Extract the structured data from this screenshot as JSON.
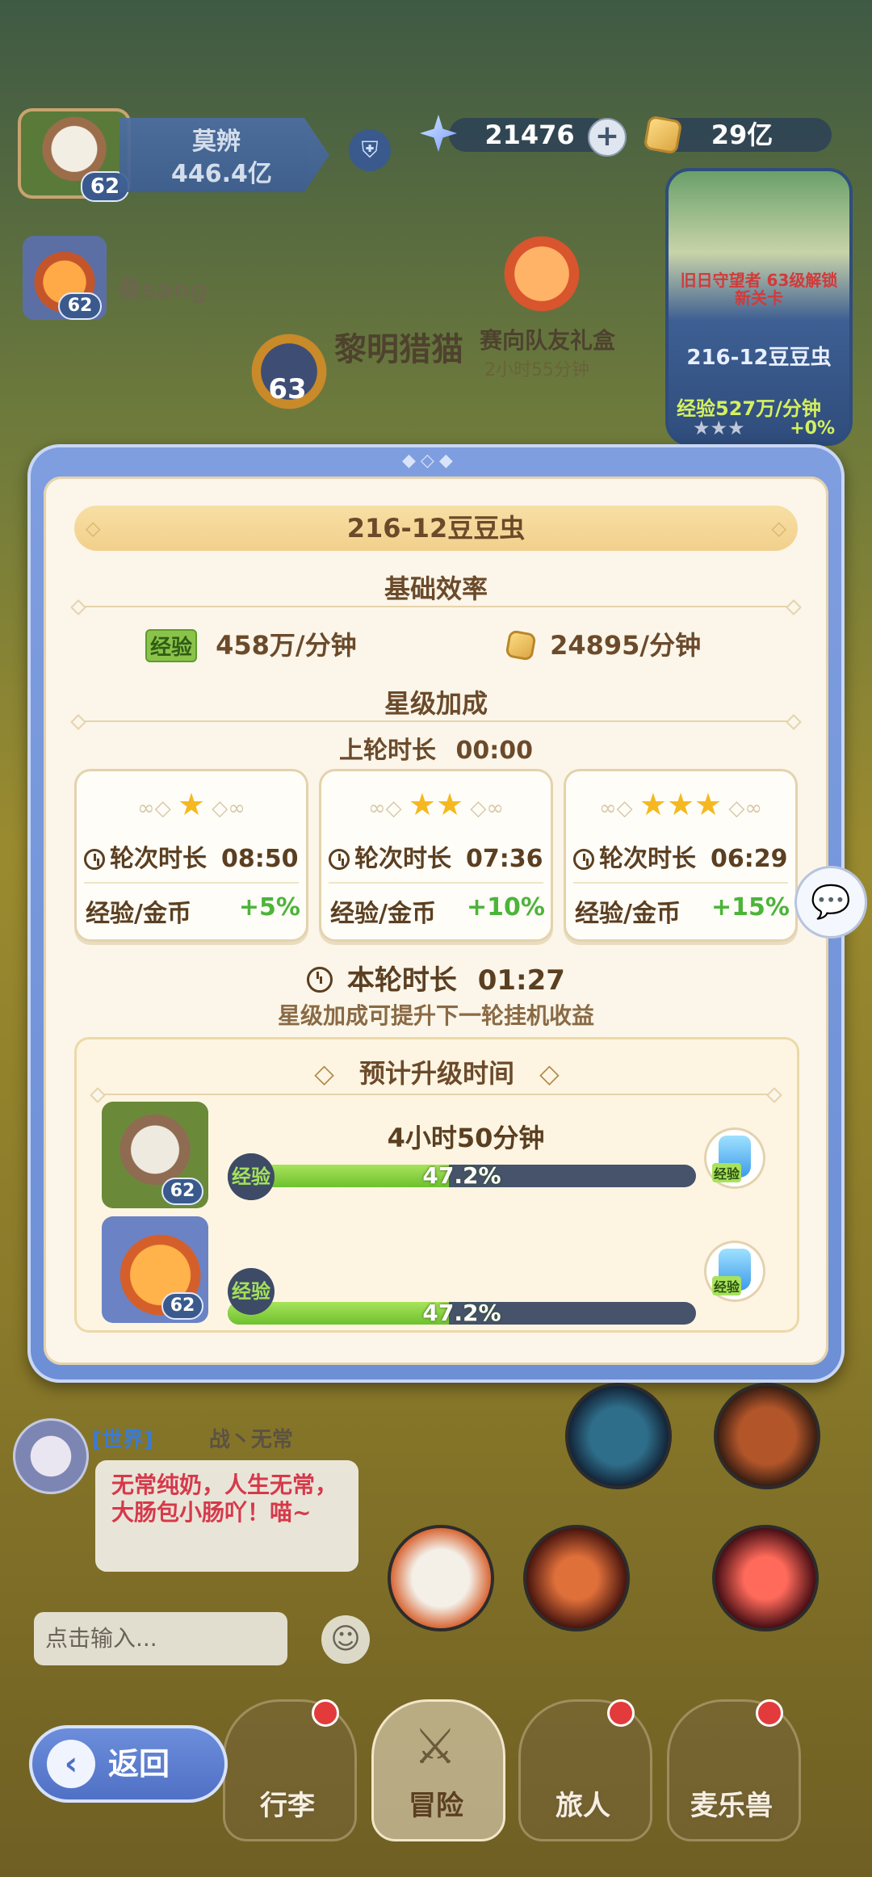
{
  "hud": {
    "player_level": "62",
    "player_name": "莫辨",
    "player_power": "446.4亿",
    "crystals": "21476",
    "gold": "29亿"
  },
  "world": {
    "teammate_level": "62",
    "teammate_name": "桑sang",
    "guide_level": "63",
    "guide_name": "黎明猎猫",
    "gift_label": "赛向队友礼盒",
    "gift_sub": "2小时55分钟"
  },
  "map_card": {
    "quest_text": "旧日守望者 63级解锁新关卡",
    "stage": "216-12豆豆虫",
    "exp_rate": "经验527万/分钟",
    "bonus": "+0%"
  },
  "modal": {
    "title": "216-12豆豆虫",
    "base_title": "基础效率",
    "exp_tag": "经验",
    "exp_rate": "458万/分钟",
    "gold_rate": "24895/分钟",
    "star_title": "星级加成",
    "last_round_label": "上轮时长",
    "last_round_value": "00:00",
    "star_cards": [
      {
        "stars": "★",
        "duration_label": "轮次时长",
        "duration": "08:50",
        "reward_label": "经验/金币",
        "bonus": "+5%"
      },
      {
        "stars": "★★",
        "duration_label": "轮次时长",
        "duration": "07:36",
        "reward_label": "经验/金币",
        "bonus": "+10%"
      },
      {
        "stars": "★★★",
        "duration_label": "轮次时长",
        "duration": "06:29",
        "reward_label": "经验/金币",
        "bonus": "+15%"
      }
    ],
    "current_round_label": "本轮时长",
    "current_round_value": "01:27",
    "hint": "星级加成可提升下一轮挂机收益",
    "upgrade_title": "预计升级时间",
    "upgrade_time": "4小时50分钟",
    "heroes": [
      {
        "level": "62",
        "exp_tag": "经验",
        "progress_text": "47.2%",
        "progress": 0.472,
        "potion_label": "经验"
      },
      {
        "level": "62",
        "exp_tag": "经验",
        "progress_text": "47.2%",
        "progress": 0.472,
        "potion_label": "经验"
      }
    ]
  },
  "chat": {
    "channel": "[世界]",
    "sender": "战丶无常",
    "message": "无常纯奶，人生无常，大肠包小肠吖！喵~",
    "input_placeholder": "点击输入..."
  },
  "nav": {
    "back": "返回",
    "items": [
      "行李",
      "冒险",
      "旅人",
      "麦乐兽"
    ]
  }
}
